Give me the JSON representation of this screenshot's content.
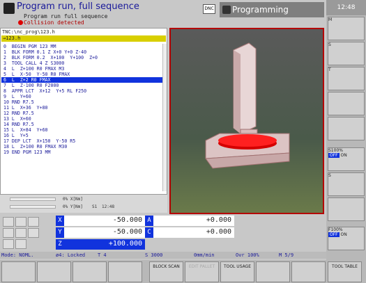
{
  "header": {
    "mode_title": "Program run, full sequence",
    "mode_sub": "Program run full sequence",
    "error": "Collision detected",
    "dnc": "DNC",
    "programming_tab": "Programming"
  },
  "clock": "12:48",
  "program": {
    "path": "TNC:\\nc_prog\\123.h",
    "file": "→123.h",
    "lines": [
      "0  BEGIN PGM 123 MM",
      "1  BLK FORM 0.1 Z X+0 Y+0 Z-40",
      "2  BLK FORM 0.2  X+100  Y+100  Z+0",
      "3  TOOL CALL 4 Z S3000",
      "4  L  Z+100 R0 FMAX M3",
      "5  L  X-50  Y-50 R0 FMAX",
      "6  L  Z+2 R0 FMAX",
      "7  L  Z-100 R0 F2000",
      "8  APPR LCT  X+12  Y+5 RL F250",
      "9  L  Y+60",
      "10 RND R7.5",
      "11 L  X+36  Y+80",
      "12 RND R7.5",
      "13 L  X+60",
      "14 RND R7.5",
      "15 L  X+84  Y+60",
      "16 L  Y+5",
      "17 DEP LCT  X+150  Y-50 R5",
      "18 L  Z+100 R0 FMAX M30",
      "19 END PGM 123 MM"
    ],
    "selected_index": 6
  },
  "status": {
    "feed_label": "0% X[Nm]",
    "spindle_label": "0% Y[Nm]",
    "s1": "S1",
    "time": "12:48"
  },
  "coords": {
    "x_label": "X",
    "x_value": "-50.000",
    "y_label": "Y",
    "y_value": "-50.000",
    "z_label": "Z",
    "z_value": "+100.000",
    "a_label": "A",
    "a_value": "+0.000",
    "c_label": "C",
    "c_value": "+0.000"
  },
  "statusline": {
    "mode": "Mode: NOML.",
    "locked": "ø4: Locked",
    "tool": "T 4",
    "spindle": "S 3000",
    "feed": "0mm/min",
    "override": "Ovr 100%",
    "m": "M 5/9"
  },
  "softkeys": {
    "block_scan": "BLOCK SCAN",
    "edit_pallet": "EDIT PALLET",
    "tool_usage": "TOOL USAGE",
    "tool_table": "TOOL TABLE"
  },
  "sidebar": {
    "m": "M",
    "s": "S",
    "t": "T",
    "s100": "S100%",
    "off": "OFF",
    "on": "ON",
    "f100": "F100%",
    "s_minus": "S"
  },
  "colors": {
    "accent": "#1133dd",
    "error": "#b40000",
    "file_bar": "#d8cf00"
  }
}
